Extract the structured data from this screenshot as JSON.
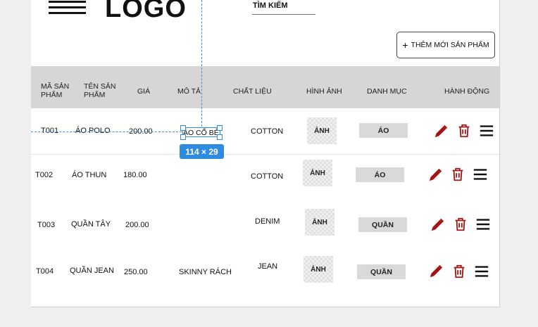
{
  "header": {
    "logo": "LOGO",
    "search_label": "TÌM KIẾM",
    "add_button_label": "THÊM MỚI SẢN PHẨM"
  },
  "table": {
    "columns": {
      "id": "MÃ SẢN PHẨM",
      "name": "TÊN SẢN PHẨM",
      "price": "GIÁ",
      "desc": "MÔ TẢ",
      "material": "CHẤT LIỆU",
      "image": "HÌNH ẢNH",
      "category": "DANH MỤC",
      "actions": "HÀNH ĐỘNG"
    },
    "rows": [
      {
        "id": "T001",
        "name": "ÁO POLO",
        "price": "200.00",
        "desc": "ÁO CỔ BẺ",
        "material": "COTTON",
        "image": "ẢNH",
        "category": "ÁO"
      },
      {
        "id": "T002",
        "name": "ÁO THUN",
        "price": "180.00",
        "desc": "",
        "material": "COTTON",
        "image": "ẢNH",
        "category": "ÁO"
      },
      {
        "id": "T003",
        "name": "QUẦN TÂY",
        "price": "200.00",
        "desc": "",
        "material": "DENIM",
        "image": "ẢNH",
        "category": "QUẦN"
      },
      {
        "id": "T004",
        "name": "QUẦN JEAN",
        "price": "250.00",
        "desc": "SKINNY RÁCH",
        "material": "JEAN",
        "image": "ẢNH",
        "category": "QUẦN"
      }
    ]
  },
  "selection": {
    "size_label": "114 × 29"
  },
  "colors": {
    "accent": "#2f8be0",
    "action_red": "#a31515",
    "header_bg": "#d6d6d6"
  },
  "icons": {
    "edit": "pencil-icon",
    "delete": "trash-icon",
    "menu": "hamburger-menu-icon"
  }
}
